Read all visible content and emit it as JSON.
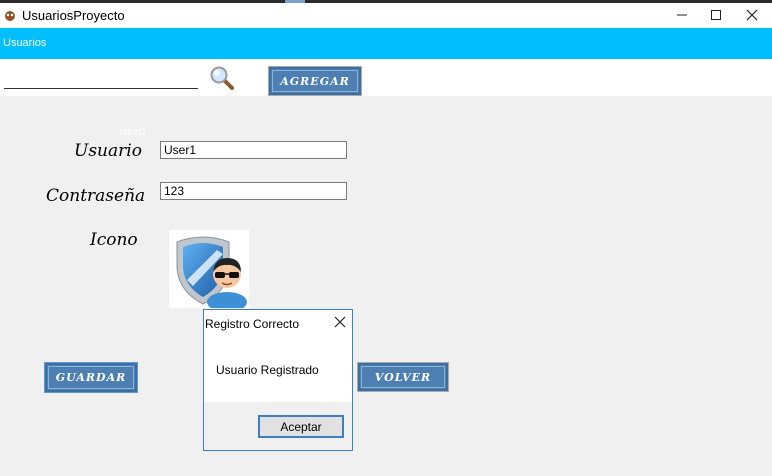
{
  "window": {
    "title": "UsuariosProyecto",
    "minimize_icon": "minimize-icon",
    "maximize_icon": "maximize-icon",
    "close_icon": "close-icon"
  },
  "menu": {
    "items": [
      "Usuarios"
    ],
    "background": "#00bfff"
  },
  "toolbar": {
    "search": {
      "value": "",
      "placeholder": ""
    },
    "search_icon": "magnifier-icon",
    "add_label": "Agregar"
  },
  "form": {
    "ghost_label": "label1",
    "usuario_label": "Usuario",
    "usuario_value": "User1",
    "password_label": "Contraseña",
    "password_value": "123",
    "icon_label": "Icono",
    "avatar_icon": "shield-user-icon",
    "save_label": "Guardar",
    "back_label": "Volver"
  },
  "dialog": {
    "title": "Registro Correcto",
    "message": "Usuario Registrado",
    "ok_label": "Aceptar"
  },
  "colors": {
    "accent": "#00bfff",
    "button_blue": "#4d7fb3",
    "dialog_border": "#3c80c4"
  }
}
